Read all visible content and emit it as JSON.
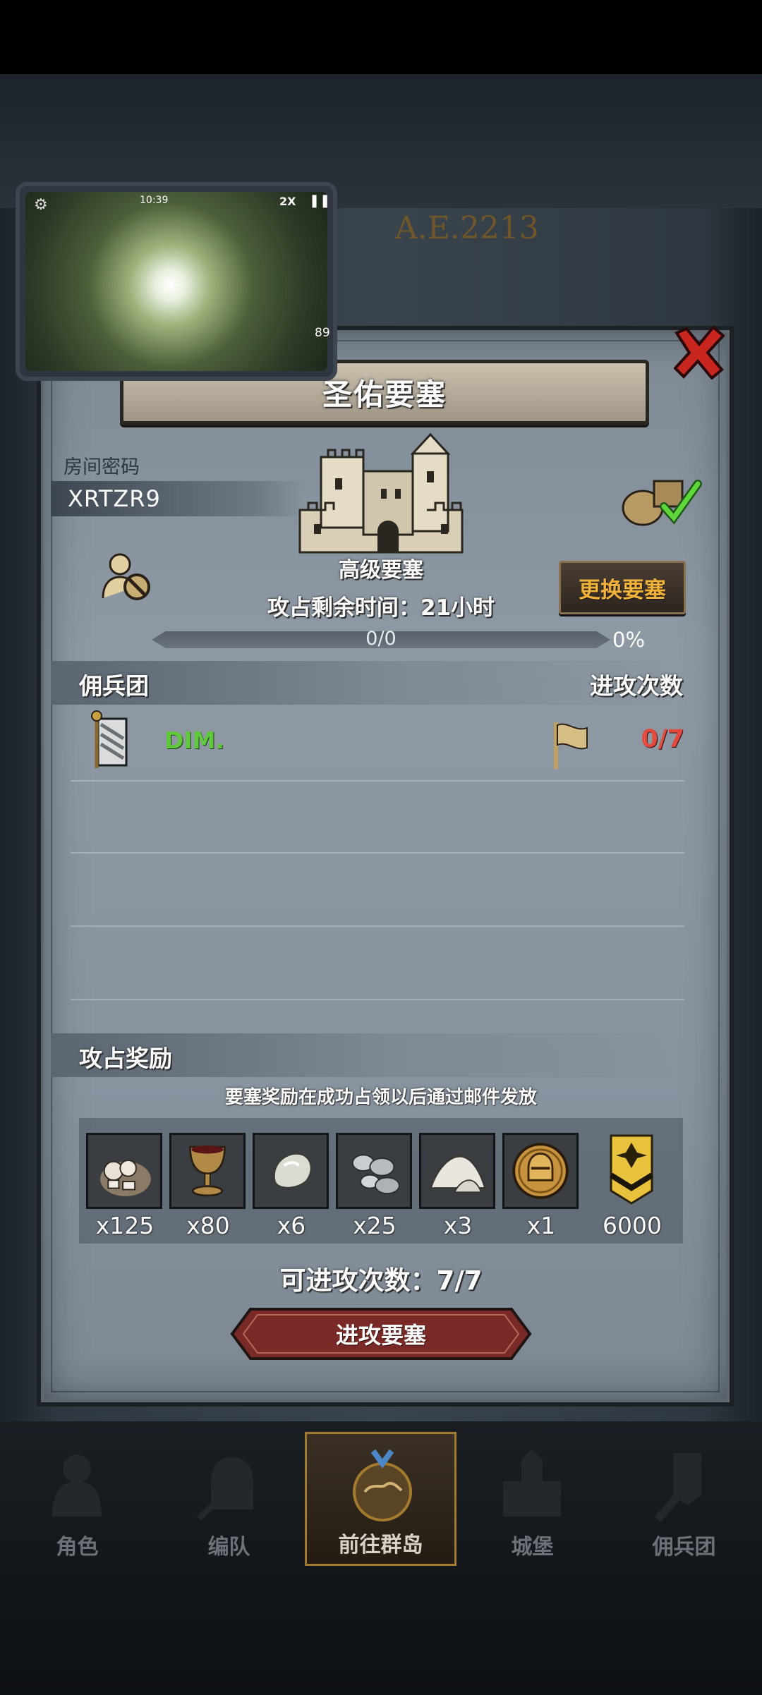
{
  "pip": {
    "time": "10:39",
    "speed": "2X",
    "pause": "❚❚",
    "gear": "⚙",
    "counter": "89"
  },
  "map": {
    "sign": "A.E.2213"
  },
  "dialog": {
    "title": "圣佑要塞",
    "room_code_label": "房间密码",
    "room_code": "XRTZR9",
    "fortress_level": "高级要塞",
    "change_button": "更换要塞",
    "time_remaining": "攻占剩余时间：21小时",
    "progress_text": "0/0",
    "progress_percent": "0%",
    "progress_value": 0
  },
  "mercenary": {
    "header_left": "佣兵团",
    "header_right": "进攻次数",
    "rows": [
      {
        "name": "DIM.",
        "attacks": "0/7"
      }
    ]
  },
  "rewards": {
    "header": "攻占奖励",
    "note": "要塞奖励在成功占领以后通过邮件发放",
    "items": [
      {
        "icon": "bandage-bundle-icon",
        "count": "x125"
      },
      {
        "icon": "goblet-icon",
        "count": "x80"
      },
      {
        "icon": "pale-stone-icon",
        "count": "x6"
      },
      {
        "icon": "silver-nuggets-icon",
        "count": "x25"
      },
      {
        "icon": "salt-pile-icon",
        "count": "x3"
      },
      {
        "icon": "knight-helmet-coin-icon",
        "count": "x1"
      }
    ],
    "points": "6000"
  },
  "attack": {
    "remaining": "可进攻次数：7/7",
    "button": "进攻要塞"
  },
  "nav": {
    "items": [
      {
        "label": "角色",
        "icon": "character-icon"
      },
      {
        "label": "编队",
        "icon": "formation-icon"
      },
      {
        "label": "前往群岛",
        "icon": "islands-icon"
      },
      {
        "label": "城堡",
        "icon": "castle-icon"
      },
      {
        "label": "佣兵团",
        "icon": "mercenary-icon"
      }
    ]
  },
  "colors": {
    "accent_gold": "#f0b23a",
    "guild_green": "#5fc83c",
    "attack_red": "#e14a3c",
    "button_red": "#7a2a26"
  }
}
